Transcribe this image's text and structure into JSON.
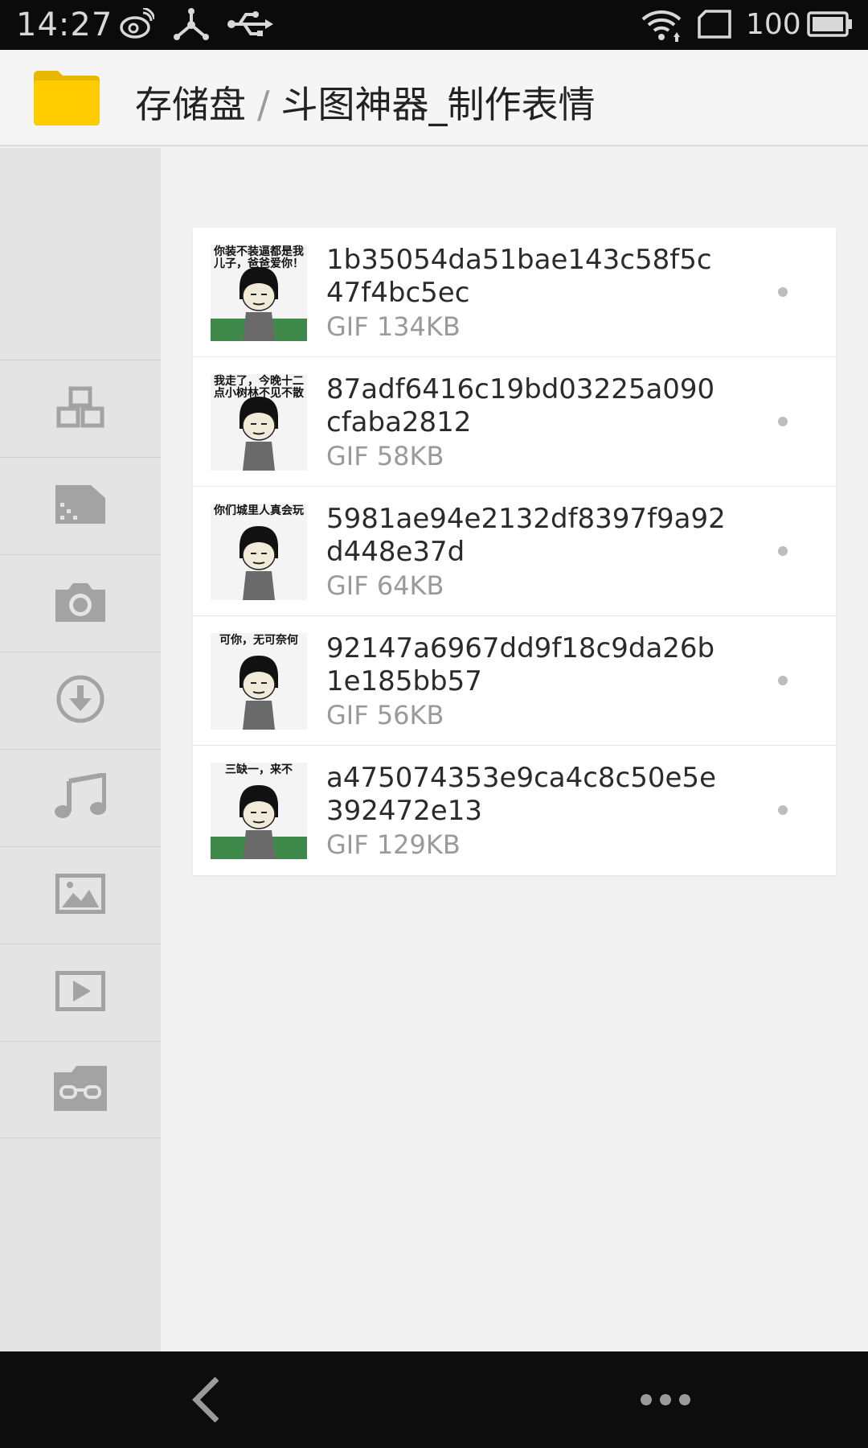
{
  "status_bar": {
    "time": "14:27",
    "battery": "100",
    "icons": [
      "weibo-icon",
      "share-hub-icon",
      "usb-icon",
      "wifi-icon",
      "sim-icon",
      "battery-icon"
    ]
  },
  "header": {
    "root": "存储盘",
    "separator": "/",
    "folder": "斗图神器_制作表情",
    "icon": "folder-icon",
    "accent": "#FFCC00"
  },
  "sidebar": {
    "items": [
      {
        "name": "apps",
        "icon": "apps-icon"
      },
      {
        "name": "sdcard",
        "icon": "sdcard-icon"
      },
      {
        "name": "camera",
        "icon": "camera-icon"
      },
      {
        "name": "downloads",
        "icon": "download-icon"
      },
      {
        "name": "music",
        "icon": "music-icon"
      },
      {
        "name": "images",
        "icon": "image-icon"
      },
      {
        "name": "videos",
        "icon": "video-icon"
      },
      {
        "name": "private",
        "icon": "glasses-icon"
      }
    ]
  },
  "files": [
    {
      "name": "1b35054da51bae143c58f5c47f4bc5ec",
      "meta": "GIF 134KB",
      "caption": "你装不装逼都是我儿子，爸爸爱你！",
      "bg": "#3f8a4a"
    },
    {
      "name": "87adf6416c19bd03225a090cfaba2812",
      "meta": "GIF 58KB",
      "caption": "我走了，今晚十二点小树林不见不散",
      "bg": "#f4f4f4"
    },
    {
      "name": "5981ae94e2132df8397f9a92d448e37d",
      "meta": "GIF 64KB",
      "caption": "你们城里人真会玩",
      "bg": "#f4f4f4"
    },
    {
      "name": "92147a6967dd9f18c9da26b1e185bb57",
      "meta": "GIF 56KB",
      "caption": "可你，无可奈何",
      "bg": "#f4f4f4"
    },
    {
      "name": "a475074353e9ca4c8c50e5e392472e13",
      "meta": "GIF 129KB",
      "caption": "三缺一，来不",
      "bg": "#3f8a4a"
    }
  ],
  "nav": {
    "back_icon": "back-icon",
    "more_icon": "more-icon"
  }
}
